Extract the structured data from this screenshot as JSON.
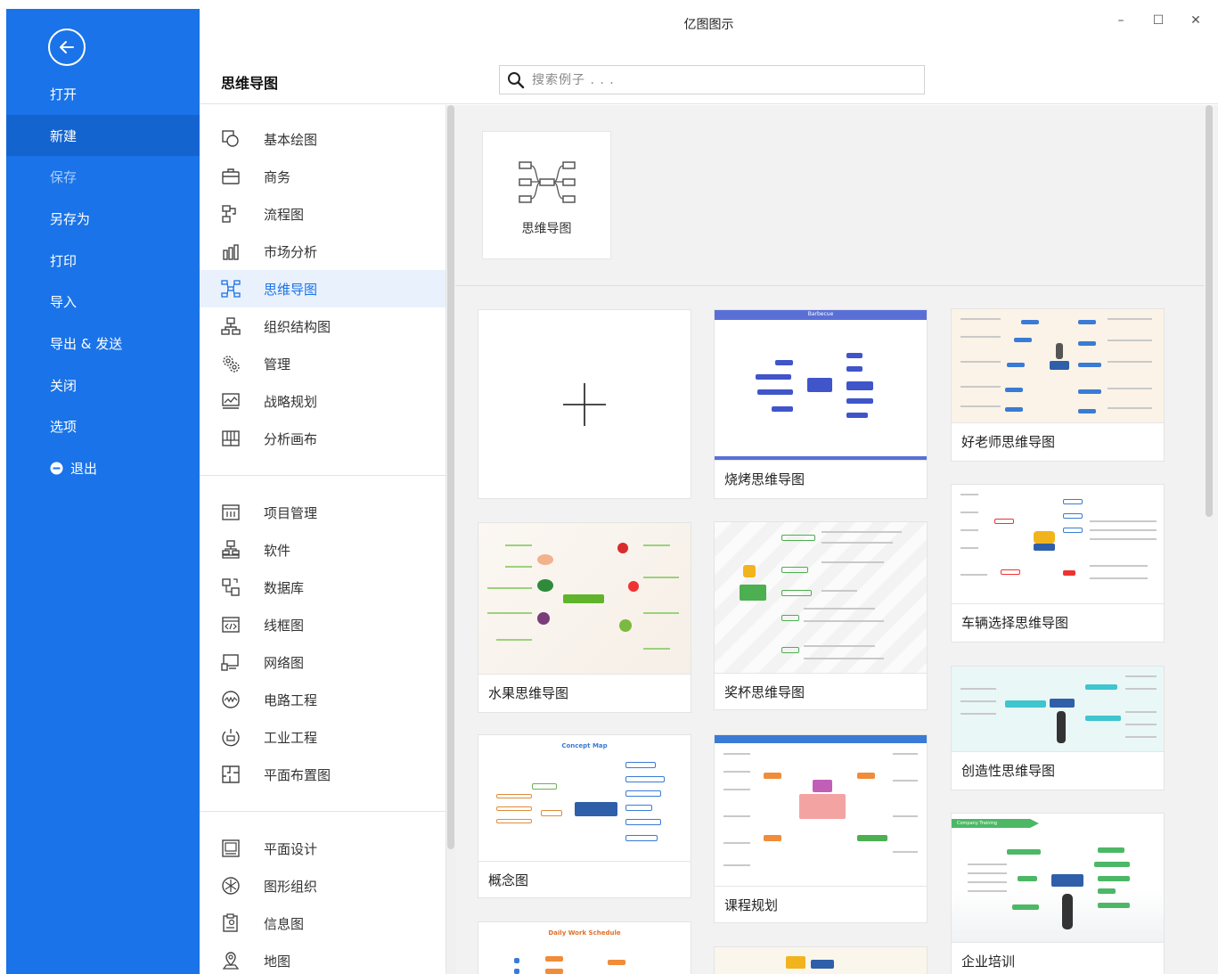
{
  "app": {
    "title": "亿图图示"
  },
  "window": {
    "minimize": "–",
    "maximize": "☐",
    "close": "✕"
  },
  "backstage": {
    "items": [
      {
        "label": "打开"
      },
      {
        "label": "新建"
      },
      {
        "label": "保存"
      },
      {
        "label": "另存为"
      },
      {
        "label": "打印"
      },
      {
        "label": "导入"
      },
      {
        "label": "导出 & 发送"
      },
      {
        "label": "关闭"
      },
      {
        "label": "选项"
      },
      {
        "label": "退出"
      }
    ]
  },
  "header": {
    "category_title": "思维导图"
  },
  "search": {
    "placeholder": "搜索例子 . . ."
  },
  "categories": {
    "group1": [
      "基本绘图",
      "商务",
      "流程图",
      "市场分析",
      "思维导图",
      "组织结构图",
      "管理",
      "战略规划",
      "分析画布"
    ],
    "group2": [
      "项目管理",
      "软件",
      "数据库",
      "线框图",
      "网络图",
      "电路工程",
      "工业工程",
      "平面布置图"
    ],
    "group3": [
      "平面设计",
      "图形组织",
      "信息图",
      "地图"
    ]
  },
  "diagram_type": {
    "label": "思维导图"
  },
  "templates": [
    {
      "name": "烧烤思维导图",
      "thumb_title": "Barbecue"
    },
    {
      "name": "好老师思维导图"
    },
    {
      "name": "水果思维导图"
    },
    {
      "name": "奖杯思维导图"
    },
    {
      "name": "车辆选择思维导图"
    },
    {
      "name": "创造性思维导图"
    },
    {
      "name": "概念图",
      "thumb_title": "Concept Map"
    },
    {
      "name": "课程规划"
    },
    {
      "name": "企业培训",
      "thumb_title": "Company Training"
    },
    {
      "thumb_title": "Daily Work Schedule"
    }
  ],
  "colors": {
    "accent": "#1a73e8",
    "selected_bg": "#e9f1fd"
  }
}
